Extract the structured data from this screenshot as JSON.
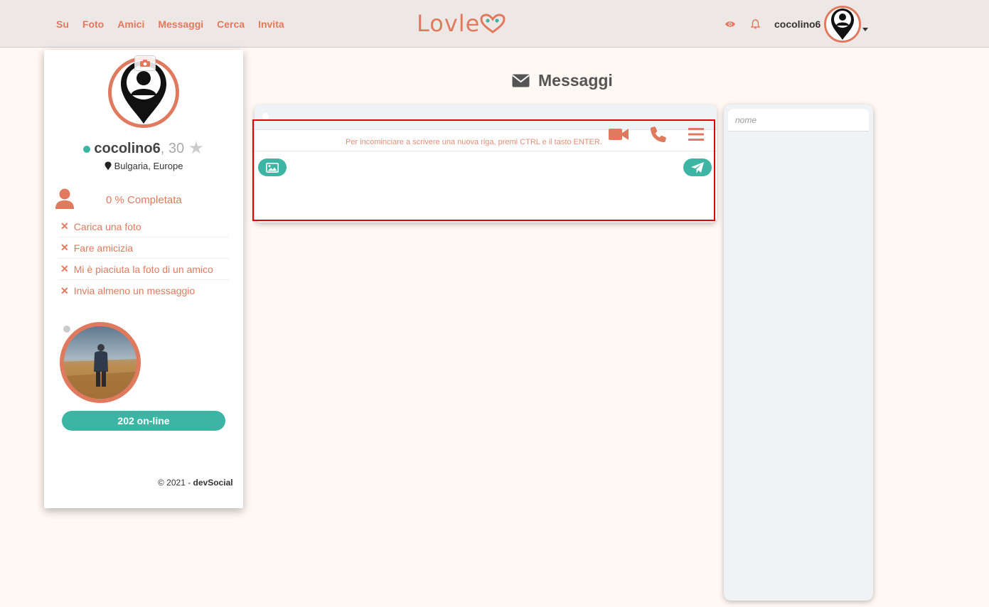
{
  "nav": {
    "items": [
      "Su",
      "Foto",
      "Amici",
      "Messaggi",
      "Cerca",
      "Invita"
    ]
  },
  "logo": {
    "text": "Lovle"
  },
  "header_user": {
    "username": "cocolino6"
  },
  "profile": {
    "name": "cocolino6",
    "age": ", 30",
    "location": "Bulgaria, Europe",
    "completion": "0 % Completata",
    "tasks": [
      "Carica una foto",
      "Fare amicizia",
      "Mi è piaciuta la foto di un amico",
      "Invia almeno un messaggio"
    ],
    "online_count": "202 on-line"
  },
  "footer": {
    "copyright": "© 2021 - ",
    "brand": "devSocial"
  },
  "messages": {
    "title": "Messaggi",
    "hint": "Per incominciare a scrivere una nuova riga, premi CTRL e il tasto ENTER."
  },
  "sidebar": {
    "search_placeholder": "nome"
  },
  "colors": {
    "accent": "#e07a5f",
    "teal": "#3db5a4",
    "background": "#fff8f3"
  }
}
